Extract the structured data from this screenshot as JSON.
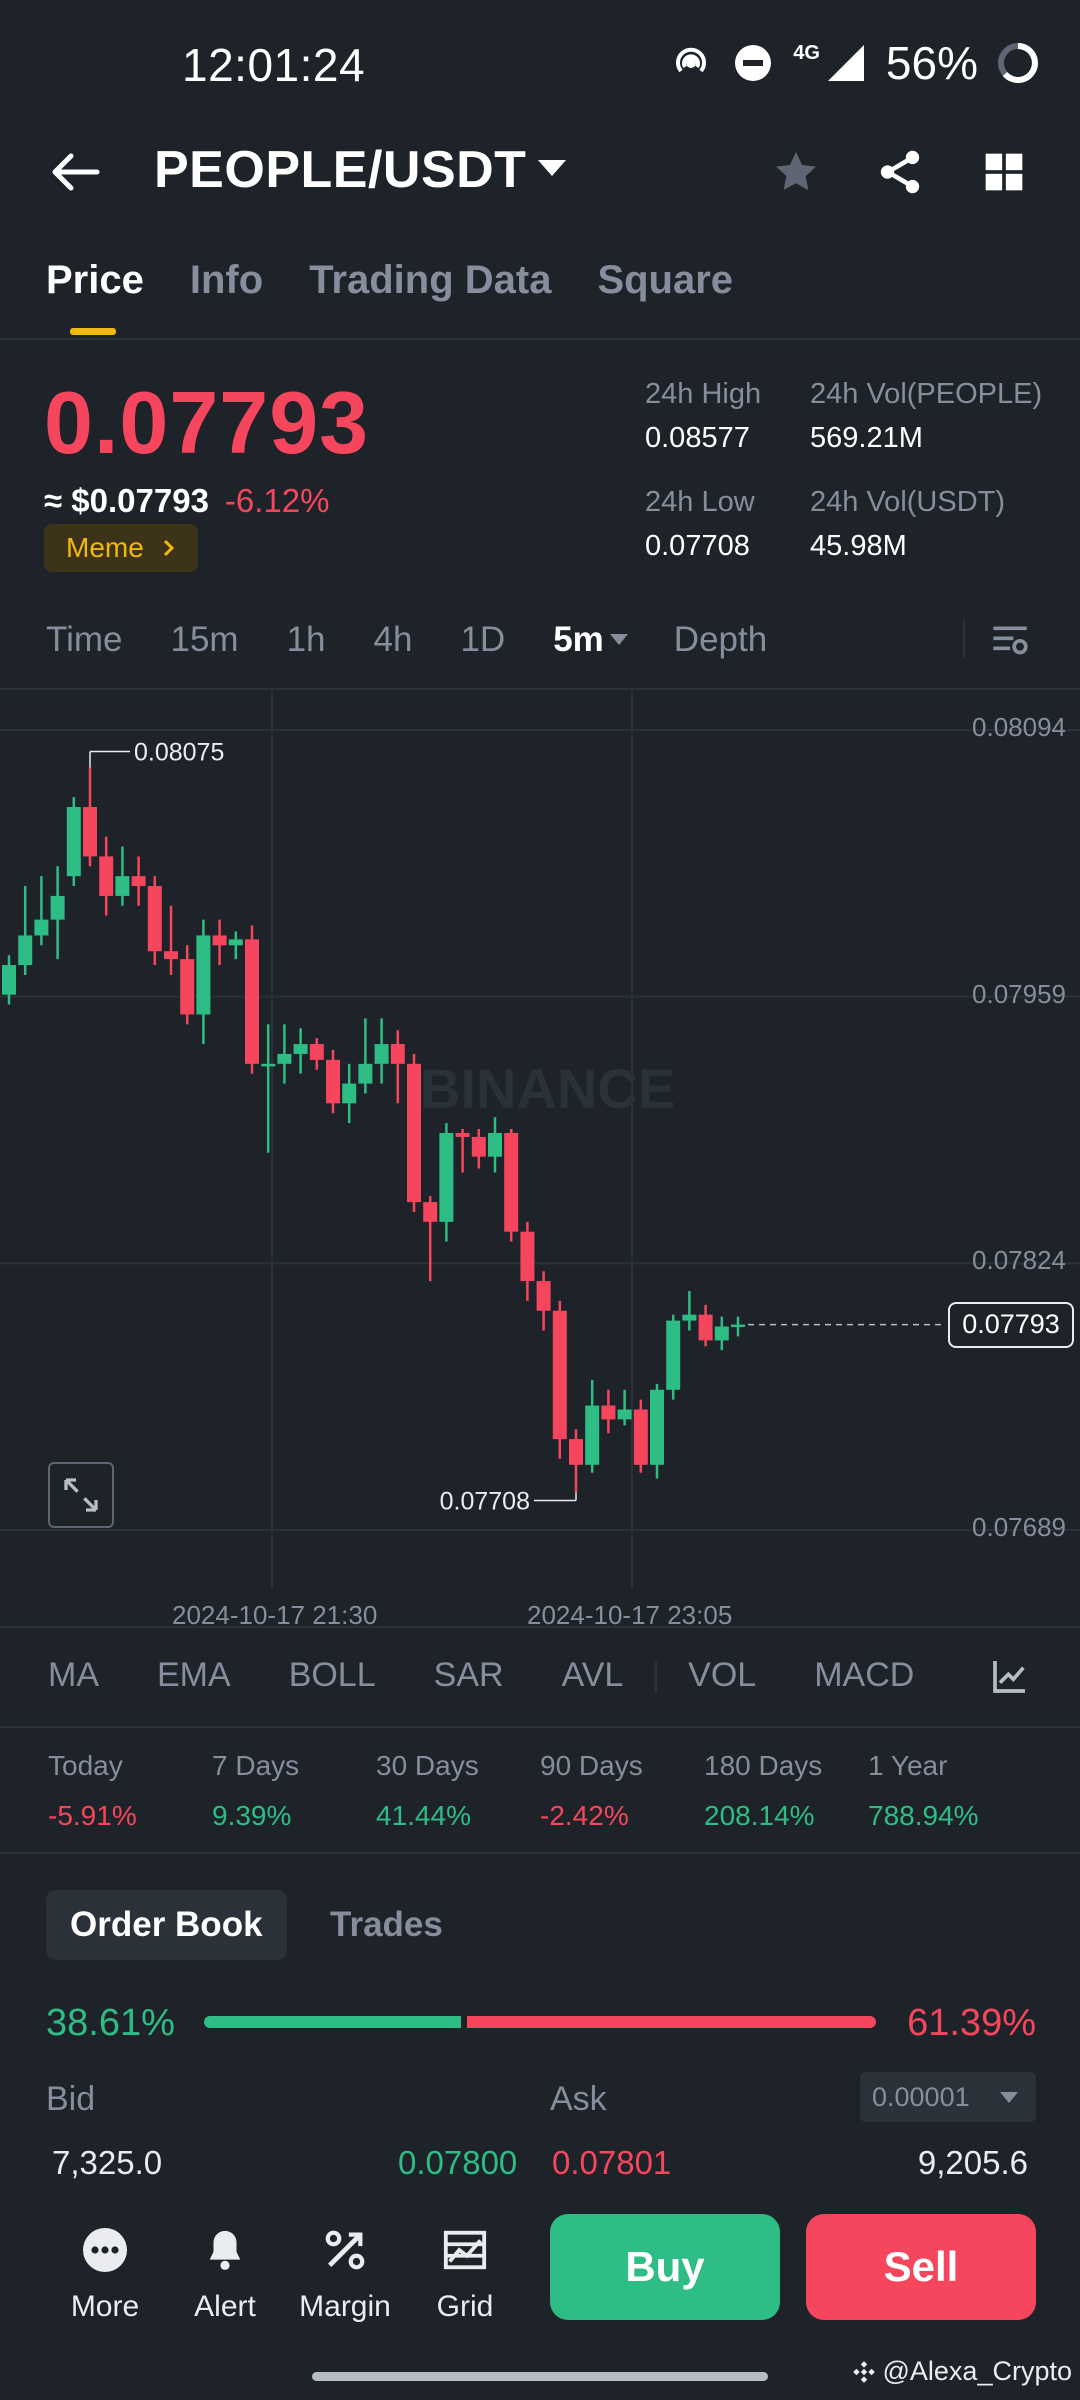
{
  "status_bar": {
    "time": "12:01:24",
    "network": "4G",
    "battery": "56%",
    "icons": [
      "hotspot-icon",
      "dnd-icon",
      "signal-icon",
      "battery-ring-icon"
    ]
  },
  "header": {
    "pair": "PEOPLE/USDT",
    "icons": [
      "back-arrow-icon",
      "caret-down-icon",
      "star-icon",
      "share-icon",
      "grid-icon"
    ]
  },
  "tabs": [
    "Price",
    "Info",
    "Trading Data",
    "Square"
  ],
  "price": {
    "last": "0.07793",
    "usd": "≈ $0.07793",
    "change": "-6.12%",
    "tag": "Meme",
    "stats": {
      "high_label": "24h High",
      "high": "0.08577",
      "low_label": "24h Low",
      "low": "0.07708",
      "vol_base_label": "24h Vol(PEOPLE)",
      "vol_base": "569.21M",
      "vol_quote_label": "24h Vol(USDT)",
      "vol_quote": "45.98M"
    }
  },
  "intervals": [
    "Time",
    "15m",
    "1h",
    "4h",
    "1D",
    "5m",
    "Depth"
  ],
  "intervals_active": "5m",
  "chart": {
    "price_axis": [
      "0.08094",
      "0.07959",
      "0.07824",
      "0.07689"
    ],
    "current_price": "0.07793",
    "high_marker": "0.08075",
    "low_marker": "0.07708",
    "watermark": "BINANCE",
    "dates": [
      "2024-10-17 21:30",
      "2024-10-17 23:05"
    ],
    "colors": {
      "up": "#2ebd85",
      "down": "#f6465d"
    }
  },
  "chart_data": {
    "type": "candlestick",
    "ylim": [
      0.07689,
      0.08094
    ],
    "x_labels": [
      "2024-10-17 21:30",
      "2024-10-17 23:05"
    ],
    "candles": [
      [
        0.0796,
        0.07975,
        0.07955,
        0.0798
      ],
      [
        0.07975,
        0.0799,
        0.0797,
        0.08015
      ],
      [
        0.0799,
        0.07998,
        0.07985,
        0.0802
      ],
      [
        0.07998,
        0.0801,
        0.07978,
        0.08025
      ],
      [
        0.0802,
        0.08055,
        0.08015,
        0.0806
      ],
      [
        0.08055,
        0.0803,
        0.08025,
        0.08075
      ],
      [
        0.0803,
        0.0801,
        0.08,
        0.0804
      ],
      [
        0.0801,
        0.0802,
        0.08005,
        0.08035
      ],
      [
        0.0802,
        0.08015,
        0.08005,
        0.0803
      ],
      [
        0.08015,
        0.07982,
        0.07975,
        0.0802
      ],
      [
        0.07982,
        0.07978,
        0.0797,
        0.08005
      ],
      [
        0.07978,
        0.0795,
        0.07945,
        0.07985
      ],
      [
        0.0795,
        0.0799,
        0.07935,
        0.07998
      ],
      [
        0.0799,
        0.07985,
        0.07975,
        0.07998
      ],
      [
        0.07985,
        0.07988,
        0.07978,
        0.07992
      ],
      [
        0.07988,
        0.07925,
        0.0792,
        0.07995
      ],
      [
        0.07925,
        0.07925,
        0.0788,
        0.07945
      ],
      [
        0.07925,
        0.0793,
        0.07915,
        0.07945
      ],
      [
        0.0793,
        0.07935,
        0.0792,
        0.07943
      ],
      [
        0.07935,
        0.07927,
        0.07922,
        0.07938
      ],
      [
        0.07927,
        0.07905,
        0.079,
        0.07932
      ],
      [
        0.07905,
        0.07915,
        0.07895,
        0.07925
      ],
      [
        0.07915,
        0.07925,
        0.0791,
        0.07948
      ],
      [
        0.07925,
        0.07935,
        0.07915,
        0.07948
      ],
      [
        0.07935,
        0.07925,
        0.07905,
        0.07942
      ],
      [
        0.07925,
        0.07855,
        0.0785,
        0.0793
      ],
      [
        0.07855,
        0.07845,
        0.07815,
        0.07858
      ],
      [
        0.07845,
        0.0789,
        0.07835,
        0.07895
      ],
      [
        0.0789,
        0.07888,
        0.0787,
        0.07892
      ],
      [
        0.07888,
        0.07878,
        0.07872,
        0.07892
      ],
      [
        0.07878,
        0.0789,
        0.0787,
        0.07898
      ],
      [
        0.0789,
        0.0784,
        0.07835,
        0.07892
      ],
      [
        0.0784,
        0.07815,
        0.07805,
        0.07845
      ],
      [
        0.07815,
        0.078,
        0.0779,
        0.0782
      ],
      [
        0.078,
        0.07735,
        0.07725,
        0.07805
      ],
      [
        0.07735,
        0.07722,
        0.07708,
        0.0774
      ],
      [
        0.07722,
        0.07752,
        0.07718,
        0.07765
      ],
      [
        0.07752,
        0.07745,
        0.07738,
        0.0776
      ],
      [
        0.07745,
        0.0775,
        0.07742,
        0.0776
      ],
      [
        0.0775,
        0.07722,
        0.07718,
        0.07755
      ],
      [
        0.07722,
        0.0776,
        0.07715,
        0.07763
      ],
      [
        0.0776,
        0.07795,
        0.07755,
        0.07798
      ],
      [
        0.07795,
        0.07798,
        0.0779,
        0.0781
      ],
      [
        0.07798,
        0.07785,
        0.07782,
        0.07803
      ],
      [
        0.07785,
        0.07792,
        0.0778,
        0.07797
      ],
      [
        0.07792,
        0.07793,
        0.07787,
        0.07797
      ]
    ],
    "candle_format": [
      "open",
      "close",
      "low",
      "high"
    ]
  },
  "indicators": [
    "MA",
    "EMA",
    "BOLL",
    "SAR",
    "AVL",
    "VOL",
    "MACD"
  ],
  "performance": [
    {
      "label": "Today",
      "value": "-5.91%",
      "dir": "down"
    },
    {
      "label": "7 Days",
      "value": "9.39%",
      "dir": "up"
    },
    {
      "label": "30 Days",
      "value": "41.44%",
      "dir": "up"
    },
    {
      "label": "90 Days",
      "value": "-2.42%",
      "dir": "down"
    },
    {
      "label": "180 Days",
      "value": "208.14%",
      "dir": "up"
    },
    {
      "label": "1 Year",
      "value": "788.94%",
      "dir": "up"
    }
  ],
  "order_book": {
    "tabs": [
      "Order Book",
      "Trades"
    ],
    "bid_ratio": "38.61%",
    "ask_ratio": "61.39%",
    "bid_fraction": 0.3861,
    "bid_label": "Bid",
    "ask_label": "Ask",
    "precision": "0.00001",
    "row": {
      "bid_qty": "7,325.0",
      "bid_price": "0.07800",
      "ask_price": "0.07801",
      "ask_qty": "9,205.6"
    }
  },
  "bottom_nav": {
    "items": [
      {
        "label": "More",
        "icon": "more-icon"
      },
      {
        "label": "Alert",
        "icon": "bell-icon"
      },
      {
        "label": "Margin",
        "icon": "margin-icon"
      },
      {
        "label": "Grid",
        "icon": "grid-bot-icon"
      }
    ],
    "buy": "Buy",
    "sell": "Sell"
  },
  "watermark_handle": "@Alexa_Crypto"
}
